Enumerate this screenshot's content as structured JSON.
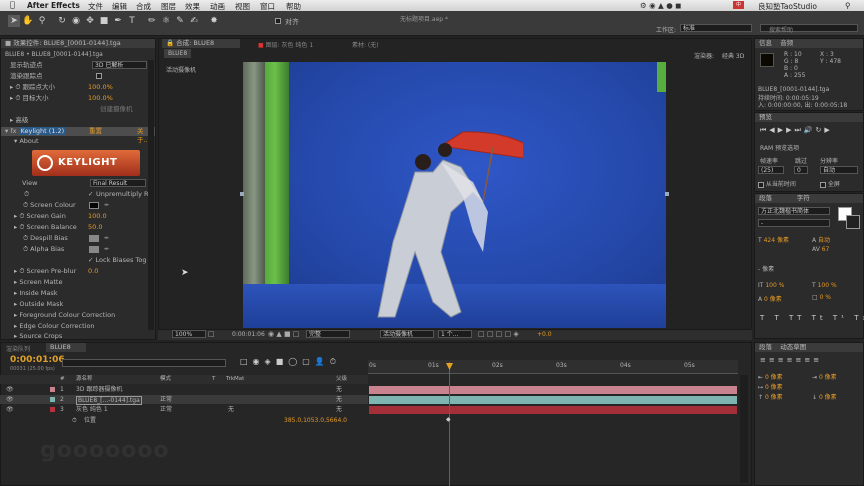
{
  "app": {
    "name": "After Effects",
    "file_title": "无标题项目.aep *",
    "watermark": "gooooooo"
  },
  "menu": [
    "文件",
    "编辑",
    "合成",
    "图层",
    "效果",
    "动画",
    "视图",
    "窗口",
    "帮助"
  ],
  "mac_status": {
    "user": "良知塾TaoStudio",
    "search_placeholder": "搜索帮助"
  },
  "toolbar": {
    "align_label": "对齐",
    "workspace_label": "工作区:",
    "workspace_value": "标准",
    "search_placeholder": "搜索帮助"
  },
  "effect_controls": {
    "tab": "效果控件: BLUE8_[0001-0144].tga",
    "layer_path": "BLUE8 • BLUE8_[0001-0144].tga",
    "rows": [
      {
        "label": "显示轨迹点",
        "value": "3D 已解析"
      },
      {
        "label": "渲染跟踪点",
        "value": ""
      },
      {
        "label": "跟踪点大小",
        "value": "100.0%"
      },
      {
        "label": "目标大小",
        "value": "100.0%"
      },
      {
        "label": "",
        "value": "创建摄像机"
      },
      {
        "label": "高级",
        "value": ""
      }
    ],
    "keylight": {
      "name": "Keylight (1.2)",
      "reset": "重置",
      "about_key": "关于...",
      "about": "About",
      "logo": "KEYLIGHT"
    },
    "params": [
      {
        "label": "View",
        "value": "Final Result"
      },
      {
        "label": "",
        "value": "Unpremultiply R"
      },
      {
        "label": "Screen Colour",
        "value": ""
      },
      {
        "label": "Screen Gain",
        "value": "100.0"
      },
      {
        "label": "Screen Balance",
        "value": "50.0"
      },
      {
        "label": "Despill Bias",
        "value": ""
      },
      {
        "label": "Alpha Bias",
        "value": ""
      },
      {
        "label": "",
        "value": "Lock Biases Tog"
      },
      {
        "label": "Screen Pre-blur",
        "value": "0.0"
      },
      {
        "label": "Screen Matte",
        "value": ""
      },
      {
        "label": "Inside Mask",
        "value": ""
      },
      {
        "label": "Outside Mask",
        "value": ""
      },
      {
        "label": "Foreground Colour Correction",
        "value": ""
      },
      {
        "label": "Edge Colour Correction",
        "value": ""
      },
      {
        "label": "Source Crops",
        "value": ""
      }
    ]
  },
  "composition": {
    "tab": "合成: BLUE8",
    "sublayer": "图层: 灰色 纯色 1",
    "footage": "素材: (无)",
    "breadcrumb": "BLUE8",
    "renderer_label": "渲染器:",
    "renderer": "经典 3D",
    "camera_label": "活动摄像机",
    "footer": {
      "zoom": "100%",
      "time": "0:00:01:06",
      "quality": "完整",
      "camera": "活动摄像机",
      "views": "1 个...",
      "exposure": "+0.0"
    }
  },
  "info": {
    "tab1": "信息",
    "tab2": "音频",
    "r": "R : 10",
    "g": "G : 8",
    "b": "B : 0",
    "a": "A : 255",
    "x": "X : 3",
    "y": "Y : 478",
    "file": "BLUE8_[0001-0144].tga",
    "duration": "持续时间: 0:00:05:19",
    "in_point": "入: 0:00:00:00, 出: 0:00:05:18"
  },
  "preview": {
    "tab": "预览",
    "ram": "RAM 预览选项",
    "fps_label": "帧速率",
    "skip_label": "跳过",
    "res_label": "分辨率",
    "fps": "(25)",
    "skip": "0",
    "res": "自动",
    "from_current": "从当前时间",
    "full_screen": "全屏"
  },
  "character": {
    "tab": "段落",
    "tab2": "字符",
    "font": "方正北魏楷书简体",
    "size": "424 像素",
    "leading": "自动",
    "tracking": "67",
    "stroke": "像素",
    "scale_v": "100 %",
    "scale_h": "100 %",
    "baseline": "0 像素",
    "tsume": "0 %"
  },
  "paragraph": {
    "tab": "段落",
    "tab2": "动态草图",
    "values": [
      "0 像素",
      "0 像素",
      "0 像素",
      "0 像素",
      "0 像素"
    ]
  },
  "timeline": {
    "tab": "渲染队列",
    "comp_tab": "BLUE8",
    "timecode": "0:00:01:06",
    "frame": "00031 (25.00 fps)",
    "headers": {
      "num": "#",
      "name": "源名称",
      "mode": "模式",
      "t": "T",
      "trkmat": "TrkMat",
      "parent": "父级"
    },
    "layers": [
      {
        "num": "1",
        "name": "3D 跟踪器摄像机",
        "mode": "",
        "trk": "",
        "parent": "无",
        "color": "#c9838f"
      },
      {
        "num": "2",
        "name": "BLUE8_[...-0144].tga",
        "mode": "正常",
        "trk": "",
        "parent": "无",
        "color": "#7fb5b0"
      },
      {
        "num": "3",
        "name": "灰色 纯色 1",
        "mode": "正常",
        "trk": "无",
        "parent": "无",
        "color": "#b8323d"
      }
    ],
    "sub": {
      "name": "位置",
      "value": "385.0,1053.0,5664.0"
    },
    "ruler": [
      "0s",
      "01s",
      "02s",
      "03s",
      "04s",
      "05s"
    ]
  }
}
